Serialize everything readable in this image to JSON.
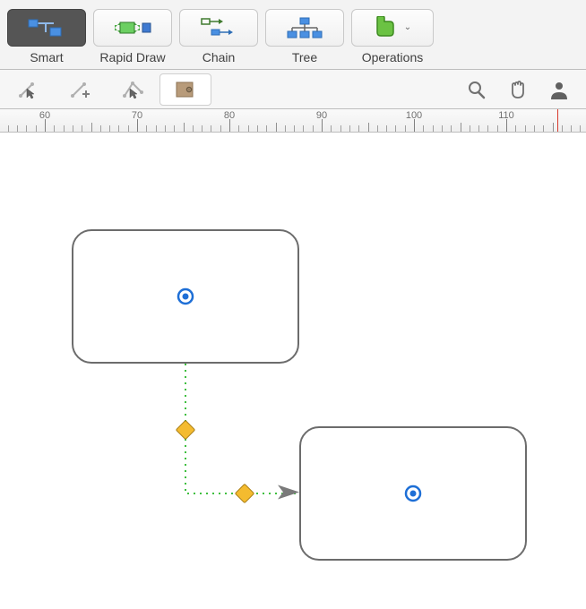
{
  "toolbar": {
    "smart": "Smart",
    "rapid_draw": "Rapid Draw",
    "chain": "Chain",
    "tree": "Tree",
    "operations": "Operations"
  },
  "ruler": {
    "labels": [
      "60",
      "70",
      "80",
      "90",
      "100",
      "110"
    ]
  },
  "colors": {
    "accent_blue": "#1e6fd6",
    "handle_yellow": "#f4bb2f",
    "connector_green": "#3fbf3f",
    "shape_border": "#6c6c6c",
    "ruler_marker": "#d83a2d"
  }
}
